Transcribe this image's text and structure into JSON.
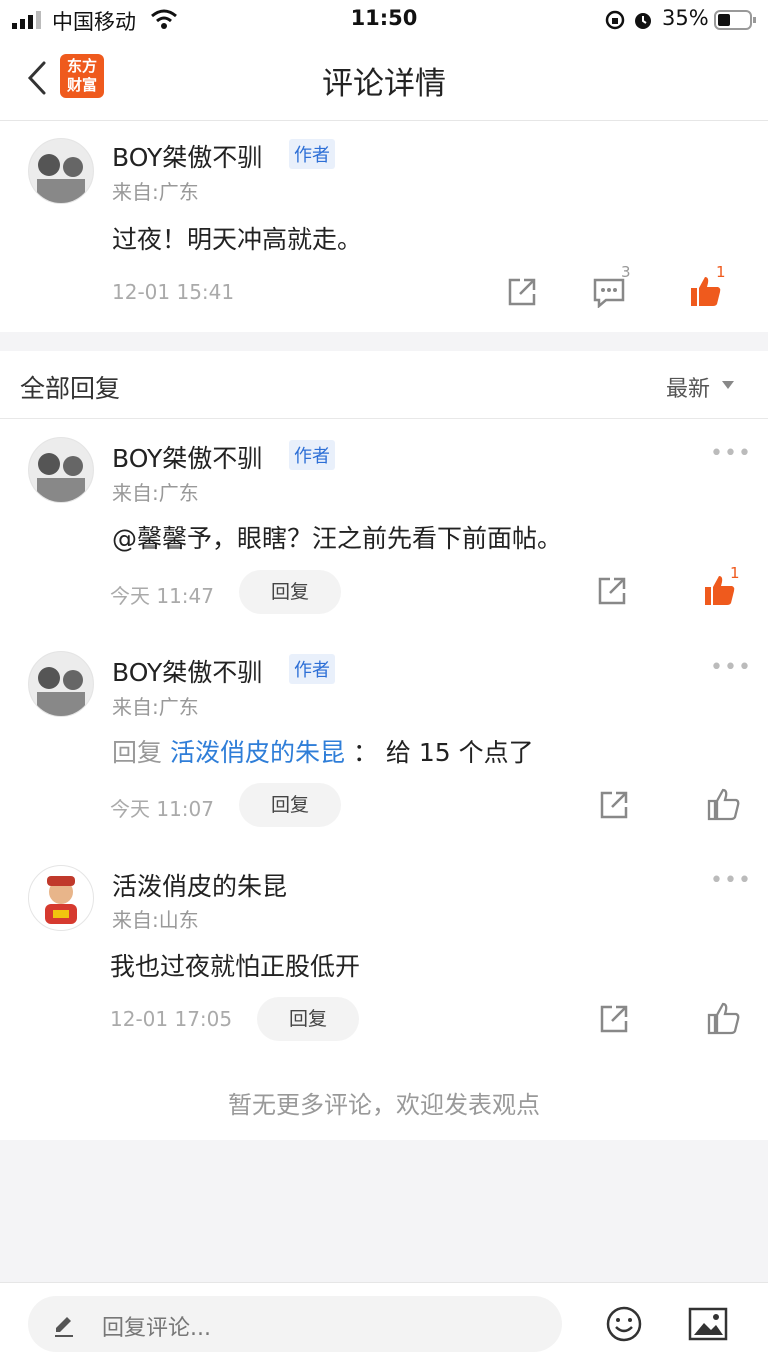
{
  "status": {
    "carrier": "中国移动",
    "time": "11:50",
    "battery": "35%"
  },
  "nav": {
    "title": "评论详情",
    "logo_line1": "东方",
    "logo_line2": "财富"
  },
  "main_post": {
    "author": "BOY桀傲不驯",
    "tag": "作者",
    "from": "来自:广东",
    "content": "过夜！明天冲高就走。",
    "time": "12-01 15:41",
    "comment_count": "3",
    "like_count": "1"
  },
  "replies_header": {
    "title": "全部回复",
    "sort": "最新"
  },
  "replies": [
    {
      "author": "BOY桀傲不驯",
      "tag": "作者",
      "from": "来自:广东",
      "content": "@馨馨予，眼瞎？汪之前先看下前面帖。",
      "time": "今天 11:47",
      "reply_label": "回复",
      "like_count": "1",
      "liked": true
    },
    {
      "author": "BOY桀傲不驯",
      "tag": "作者",
      "from": "来自:广东",
      "reply_prefix": "回复",
      "reply_to": "活泼俏皮的朱昆",
      "reply_sep": "：",
      "content": "给 15 个点了",
      "time": "今天 11:07",
      "reply_label": "回复",
      "like_count": "",
      "liked": false
    },
    {
      "author": "活泼俏皮的朱昆",
      "tag": "",
      "from": "来自:山东",
      "content": "我也过夜就怕正股低开",
      "time": "12-01 17:05",
      "reply_label": "回复",
      "like_count": "",
      "liked": false
    }
  ],
  "footer_note": "暂无更多评论，欢迎发表观点",
  "bottom": {
    "placeholder": "回复评论..."
  },
  "colors": {
    "accent": "#ef5a1d",
    "link": "#2f7ed8",
    "tag_bg": "#e9f0fb"
  }
}
